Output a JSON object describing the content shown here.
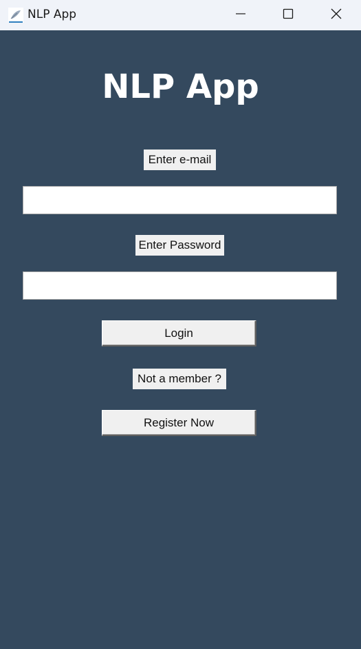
{
  "window": {
    "title": "NLP App",
    "app_icon": "feather-icon",
    "controls": {
      "minimize_icon": "minimize-icon",
      "maximize_icon": "maximize-icon",
      "close_icon": "close-icon"
    }
  },
  "colors": {
    "background": "#34495e",
    "titlebar": "#f0f3f9",
    "label_bg": "#f0f0f0",
    "title_text": "#ffffff"
  },
  "main": {
    "heading": "NLP App",
    "email_label": "Enter e-mail",
    "email_value": "",
    "password_label": "Enter Password",
    "password_value": "",
    "login_button": "Login",
    "member_prompt": "Not a member ?",
    "register_button": "Register Now"
  }
}
